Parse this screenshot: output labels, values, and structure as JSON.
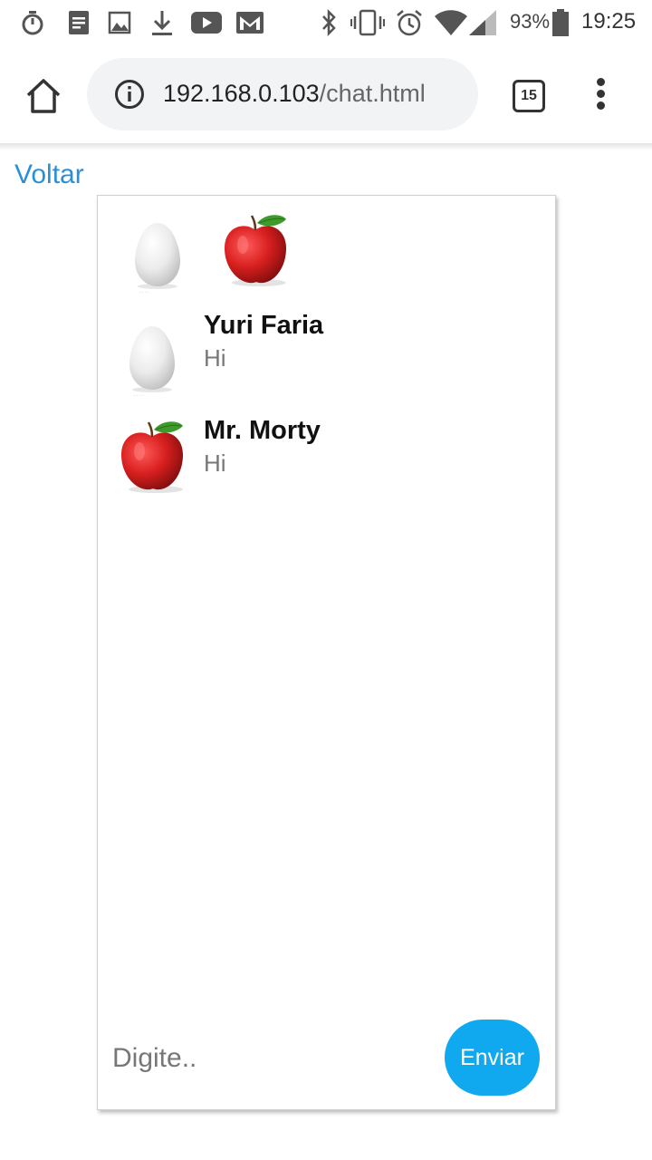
{
  "status_bar": {
    "battery": "93%",
    "time": "19:25",
    "icons": [
      "stopwatch-icon",
      "notes-icon",
      "image-icon",
      "download-icon",
      "youtube-icon",
      "gmail-icon",
      "bluetooth-icon",
      "vibrate-icon",
      "alarm-icon",
      "wifi-icon",
      "signal-icon",
      "battery-icon"
    ]
  },
  "browser": {
    "url_host": "192.168.0.103",
    "url_path": "/chat.html",
    "tab_count": "15"
  },
  "page": {
    "back_link": "Voltar",
    "header_avatars": [
      "egg-avatar",
      "apple-avatar"
    ],
    "messages": [
      {
        "name": "Yuri Faria",
        "text": "Hi",
        "avatar": "egg-avatar"
      },
      {
        "name": "Mr. Morty",
        "text": "Hi",
        "avatar": "apple-avatar"
      }
    ],
    "input_placeholder": "Digite..",
    "send_label": "Enviar"
  },
  "colors": {
    "link": "#2b8fd6",
    "send_button": "#10a9ef",
    "url_bar": "#f1f3f4"
  }
}
